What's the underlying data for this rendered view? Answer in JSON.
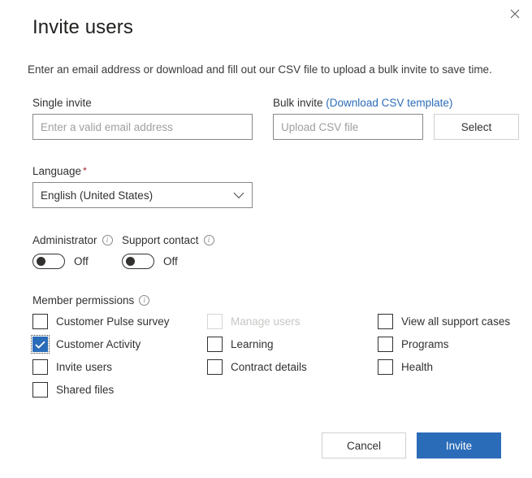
{
  "dialog": {
    "title": "Invite users",
    "subtitle": "Enter an email address or download and fill out our CSV file to upload a bulk invite to save time.",
    "close_icon": "close-icon"
  },
  "single_invite": {
    "label": "Single invite",
    "placeholder": "Enter a valid email address",
    "value": ""
  },
  "bulk_invite": {
    "label": "Bulk invite",
    "link_text": "(Download CSV template)",
    "placeholder": "Upload CSV file",
    "value": "",
    "select_label": "Select"
  },
  "language": {
    "label": "Language",
    "required_marker": "*",
    "selected": "English (United States)",
    "chevron_icon": "chevron-down-icon"
  },
  "toggles": [
    {
      "label": "Administrator",
      "info_icon": "info-icon",
      "state_label": "Off",
      "checked": false
    },
    {
      "label": "Support contact",
      "info_icon": "info-icon",
      "state_label": "Off",
      "checked": false
    }
  ],
  "permissions": {
    "heading": "Member permissions",
    "info_icon": "info-icon",
    "columns": [
      [
        {
          "label": "Customer Pulse survey",
          "checked": false,
          "disabled": false
        },
        {
          "label": "Customer Activity",
          "checked": true,
          "disabled": false
        },
        {
          "label": "Invite users",
          "checked": false,
          "disabled": false
        },
        {
          "label": "Shared files",
          "checked": false,
          "disabled": false
        }
      ],
      [
        {
          "label": "Manage users",
          "checked": false,
          "disabled": true
        },
        {
          "label": "Learning",
          "checked": false,
          "disabled": false
        },
        {
          "label": "Contract details",
          "checked": false,
          "disabled": false
        }
      ],
      [
        {
          "label": "View all support cases",
          "checked": false,
          "disabled": false
        },
        {
          "label": "Programs",
          "checked": false,
          "disabled": false
        },
        {
          "label": "Health",
          "checked": false,
          "disabled": false
        }
      ]
    ]
  },
  "footer": {
    "cancel_label": "Cancel",
    "invite_label": "Invite"
  },
  "colors": {
    "accent": "#2b6cb8",
    "link": "#2b6cb8",
    "required": "#a4262c",
    "text": "#323130",
    "disabled_text": "#c8c6c4",
    "border": "#8a8886"
  }
}
